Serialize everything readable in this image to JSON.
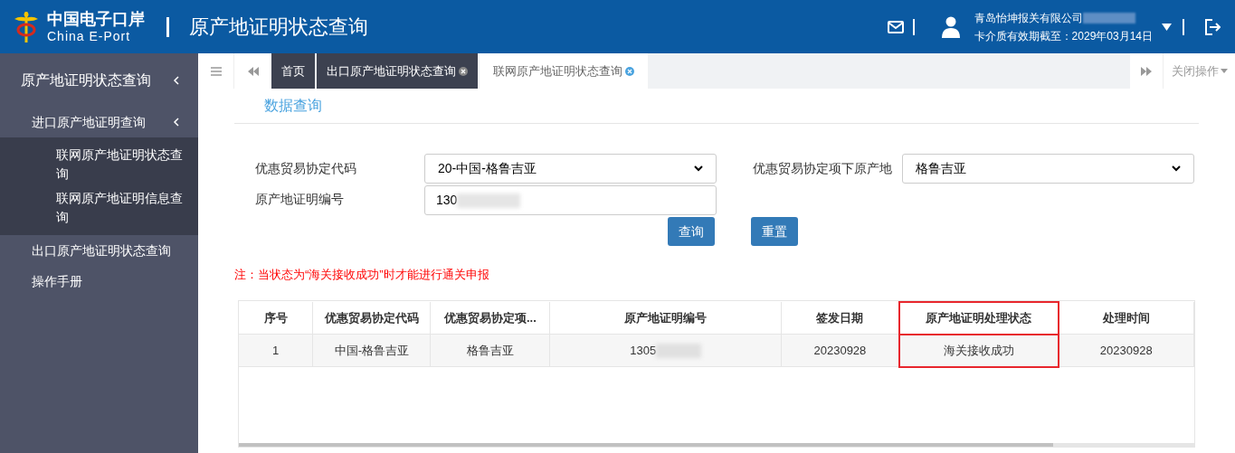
{
  "header": {
    "logo_cn": "中国电子口岸",
    "logo_en": "China E-Port",
    "title": "原产地证明状态查询",
    "company": "青岛怡坤报关有限公司",
    "validity": "卡介质有效期截至：2029年03月14日"
  },
  "sidebar": {
    "items": [
      {
        "label": "原产地证明状态查询",
        "expanded": true,
        "children": [
          {
            "label": "进口原产地证明查询",
            "expanded": true,
            "children": [
              {
                "label": "联网原产地证明状态查询"
              },
              {
                "label": "联网原产地证明信息查询"
              }
            ]
          },
          {
            "label": "出口原产地证明状态查询"
          },
          {
            "label": "操作手册"
          }
        ]
      }
    ]
  },
  "tabs": [
    {
      "label": "首页",
      "selected": false,
      "closable": false
    },
    {
      "label": "出口原产地证明状态查询",
      "selected": false,
      "closable": true
    },
    {
      "label": "联网原产地证明状态查询",
      "selected": true,
      "closable": true
    }
  ],
  "close_menu": "关闭操作",
  "section_title": "数据查询",
  "form": {
    "fields": [
      {
        "kind": "select",
        "label": "优惠贸易协定代码",
        "value": "20-中国-格鲁吉亚"
      },
      {
        "kind": "select",
        "label": "优惠贸易协定项下原产地",
        "value": "格鲁吉亚"
      },
      {
        "kind": "input",
        "label": "原产地证明编号",
        "value": "130",
        "redacted": true
      }
    ],
    "buttons": [
      "查询",
      "重置"
    ]
  },
  "note": "注：当状态为“海关接收成功”时才能进行通关申报",
  "table": {
    "columns": [
      {
        "label": "序号",
        "highlighted": false
      },
      {
        "label": "优惠贸易协定代码",
        "highlighted": false
      },
      {
        "label": "优惠贸易协定项...",
        "highlighted": false
      },
      {
        "label": "原产地证明编号",
        "highlighted": false
      },
      {
        "label": "签发日期",
        "highlighted": false
      },
      {
        "label": "原产地证明处理状态",
        "highlighted": true
      },
      {
        "label": "处理时间",
        "highlighted": false
      }
    ],
    "rows": [
      [
        "1",
        "中国-格鲁吉亚",
        "格鲁吉亚",
        "1305",
        "20230928",
        "海关接收成功",
        "20230928"
      ]
    ]
  }
}
